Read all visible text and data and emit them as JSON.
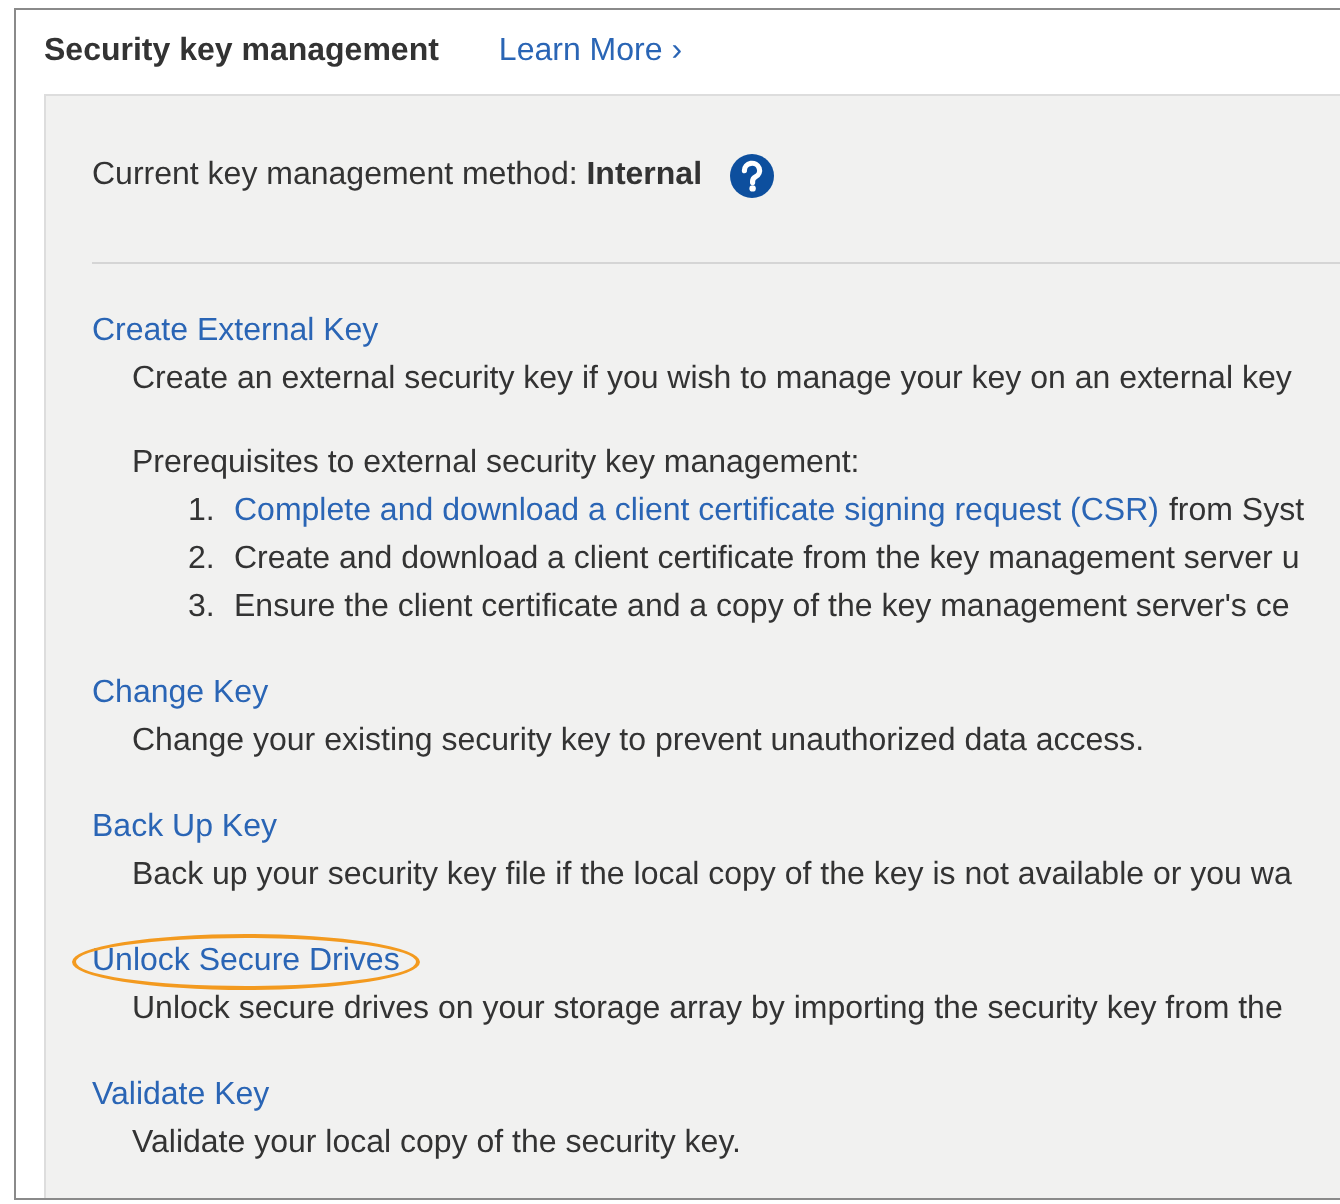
{
  "header": {
    "title": "Security key management",
    "learn_more": "Learn More ›"
  },
  "current_method": {
    "label": "Current key management method:",
    "value": "Internal"
  },
  "actions": [
    {
      "title": "Create External Key",
      "description": "Create an external security key if you wish to manage your key on an external key",
      "highlighted": false,
      "prerequisites": {
        "heading": "Prerequisites to external security key management:",
        "steps": [
          {
            "number": "1.",
            "link": "Complete and download a client certificate signing request (CSR)",
            "text": "from Syst"
          },
          {
            "number": "2.",
            "text": "Create and download a client certificate from the key management server u"
          },
          {
            "number": "3.",
            "text": "Ensure the client certificate and a copy of the key management server's ce"
          }
        ]
      }
    },
    {
      "title": "Change Key",
      "description": "Change your existing security key to prevent unauthorized data access.",
      "highlighted": false
    },
    {
      "title": "Back Up Key",
      "description": "Back up your security key file if the local copy of the key is not available or you wa",
      "highlighted": false
    },
    {
      "title": "Unlock Secure Drives",
      "description": "Unlock secure drives on your storage array by importing the security key from the",
      "highlighted": true
    },
    {
      "title": "Validate Key",
      "description": "Validate your local copy of the security key.",
      "highlighted": false
    }
  ]
}
